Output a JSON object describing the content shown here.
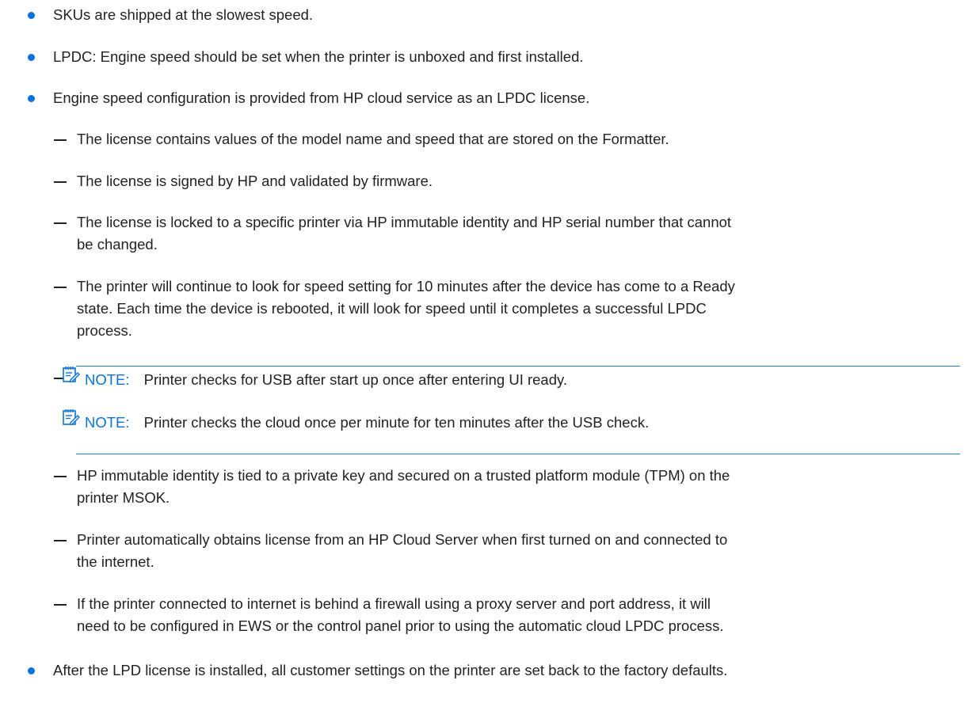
{
  "colors": {
    "bullet": "#0a73d9",
    "note_label": "#0a73d9",
    "note_rule": "#1f7fc7",
    "text": "#222222"
  },
  "items": [
    {
      "text": "SKUs are shipped at the slowest speed."
    },
    {
      "text": "LPDC: Engine speed should be set when the printer is unboxed and first installed."
    },
    {
      "text": "Engine speed configuration is provided from HP cloud service as an LPDC license."
    }
  ],
  "subitems": [
    {
      "text": "The license contains values of the model name and speed that are stored on the Formatter."
    },
    {
      "text": "The license is signed by HP and validated by firmware."
    },
    {
      "line1": "The license is locked to a specific printer via HP immutable identity and HP serial number that cannot",
      "line2": "be changed."
    },
    {
      "line1": "The printer will continue to look for speed setting for 10 minutes after the device has come to a Ready",
      "line2": "state. Each time the device is rebooted, it will look for speed until it completes a successful LPDC",
      "line3": "process."
    }
  ],
  "notes": [
    {
      "icon": "note-icon",
      "label": "NOTE:",
      "text": "Printer checks for USB after start up once after entering UI ready."
    },
    {
      "icon": "note-icon",
      "label": "NOTE:",
      "text": "Printer checks the cloud once per minute for ten minutes after the USB check."
    }
  ],
  "subitems2": [
    {
      "line1": "HP immutable identity is tied to a private key and secured on a trusted platform module (TPM) on the",
      "line2": "printer MSOK."
    },
    {
      "line1": "Printer automatically obtains license from an HP Cloud Server when first turned on and connected to",
      "line2": "the internet."
    },
    {
      "line1": "If the printer connected to internet is behind a firewall using a proxy server and port address, it will",
      "line2": "need to be configured in EWS or the control panel prior to using the automatic cloud LPDC process."
    }
  ],
  "final_item": {
    "text": "After the LPD license is installed, all customer settings on the printer are set back to the factory defaults."
  }
}
